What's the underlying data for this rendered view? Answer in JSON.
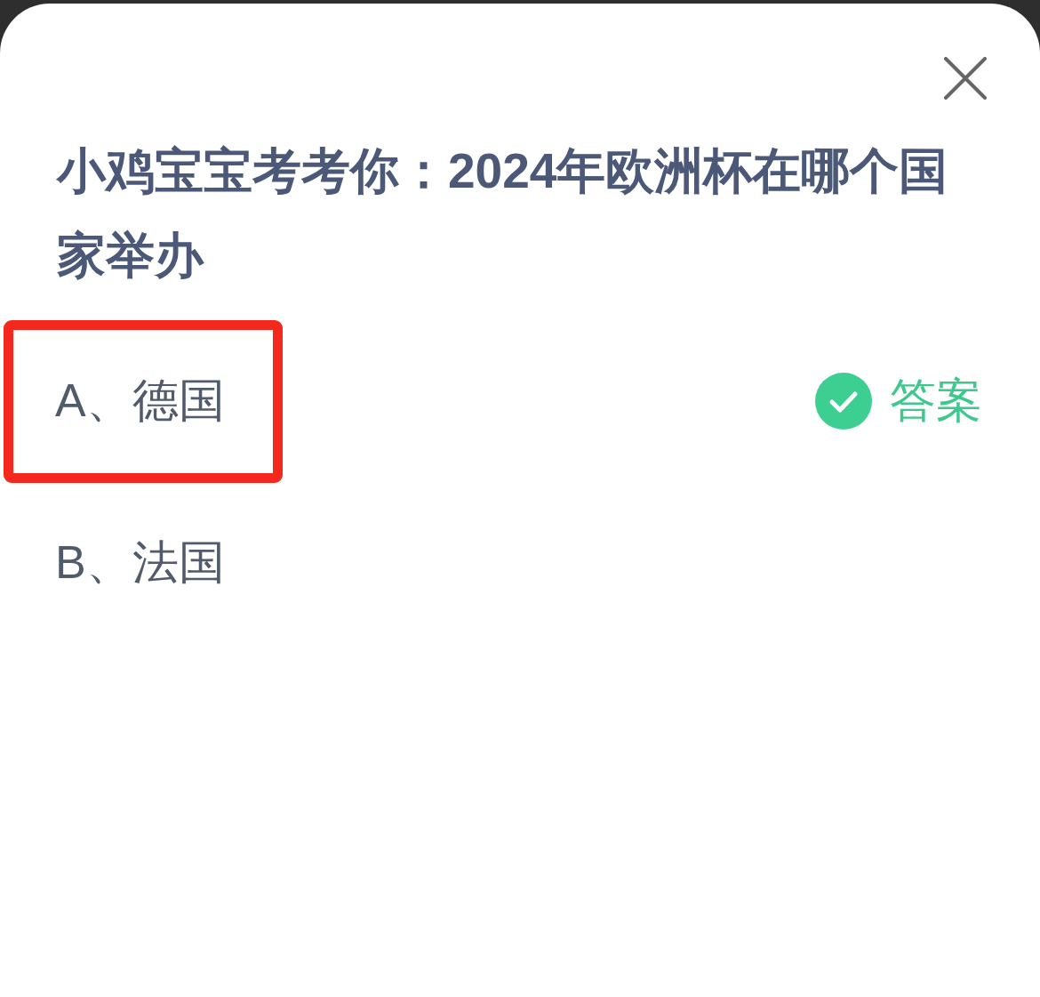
{
  "question": "小鸡宝宝考考你：2024年欧洲杯在哪个国家举办",
  "options": [
    {
      "label": "A、德国",
      "highlighted": true,
      "answer_tag": "答案"
    },
    {
      "label": "B、法国",
      "highlighted": false
    }
  ]
}
